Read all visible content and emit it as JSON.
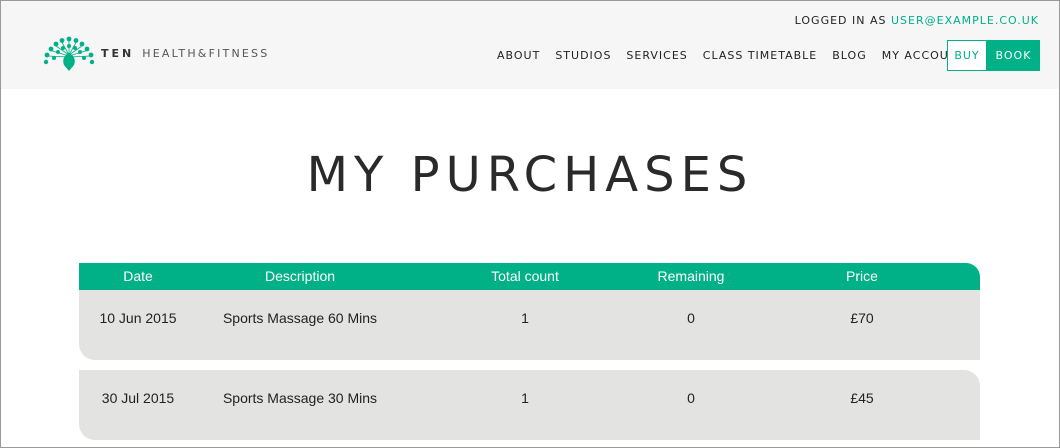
{
  "header": {
    "logged_in_prefix": "LOGGED IN AS ",
    "logged_in_email": "USER@EXAMPLE.CO.UK",
    "brand_bold": "TEN",
    "brand_rest": "HEALTH&FITNESS",
    "nav": [
      "ABOUT",
      "STUDIOS",
      "SERVICES",
      "CLASS TIMETABLE",
      "BLOG",
      "MY ACCOUNT"
    ],
    "buy_label": "BUY",
    "book_label": "BOOK",
    "accent_color": "#00b086"
  },
  "main": {
    "title": "MY PURCHASES",
    "columns": [
      "Date",
      "Description",
      "Total count",
      "Remaining",
      "Price"
    ],
    "rows": [
      {
        "date": "10 Jun 2015",
        "description": "Sports Massage 60 Mins",
        "total": "1",
        "remaining": "0",
        "price": "£70"
      },
      {
        "date": "30 Jul 2015",
        "description": "Sports Massage 30 Mins",
        "total": "1",
        "remaining": "0",
        "price": "£45"
      }
    ]
  }
}
